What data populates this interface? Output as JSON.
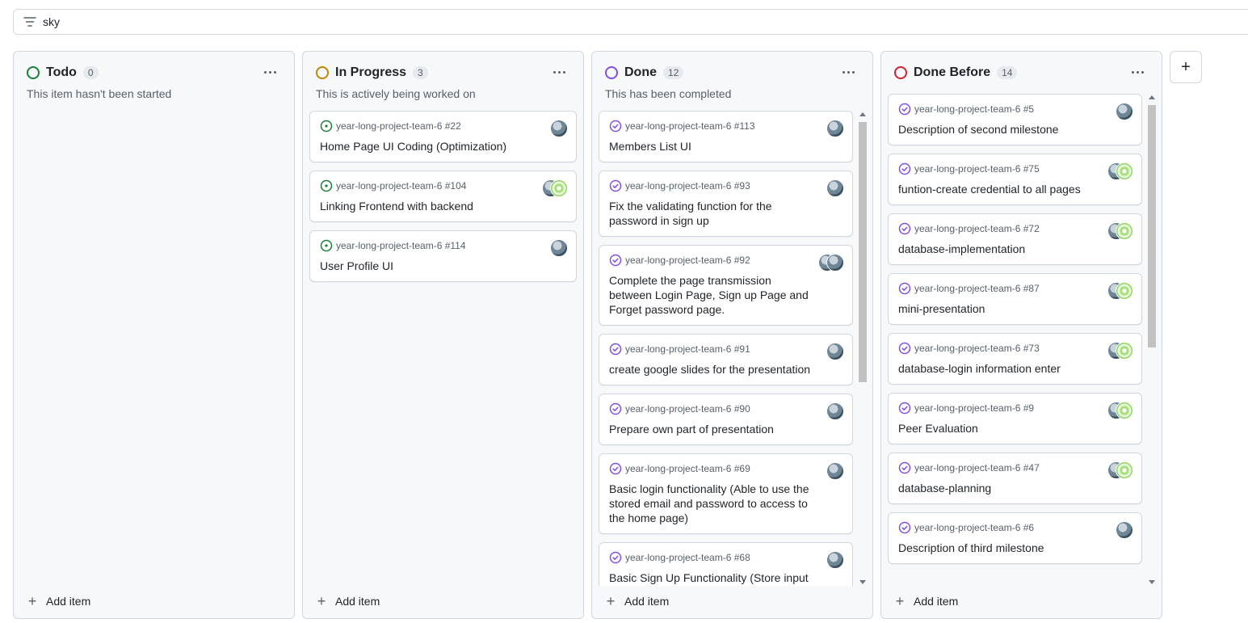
{
  "filter": {
    "query": "sky"
  },
  "columns": [
    {
      "title": "Todo",
      "count": "0",
      "description": "This item hasn't been started",
      "color": "#1a7f37",
      "add_label": "Add item",
      "scroll": false,
      "cards": []
    },
    {
      "title": "In Progress",
      "count": "3",
      "description": "This is actively being worked on",
      "color": "#bf8700",
      "add_label": "Add item",
      "scroll": false,
      "cards": [
        {
          "ref": "year-long-project-team-6 #22",
          "title": "Home Page UI Coding (Optimization)",
          "state": "open",
          "avatars": [
            "photo"
          ]
        },
        {
          "ref": "year-long-project-team-6 #104",
          "title": "Linking Frontend with backend",
          "state": "open",
          "avatars": [
            "photo",
            "green"
          ]
        },
        {
          "ref": "year-long-project-team-6 #114",
          "title": "User Profile UI",
          "state": "open",
          "avatars": [
            "photo"
          ]
        }
      ]
    },
    {
      "title": "Done",
      "count": "12",
      "description": "This has been completed",
      "color": "#8250df",
      "add_label": "Add item",
      "scroll": true,
      "cards": [
        {
          "ref": "year-long-project-team-6 #113",
          "title": "Members List UI",
          "state": "done",
          "avatars": [
            "photo"
          ]
        },
        {
          "ref": "year-long-project-team-6 #93",
          "title": "Fix the validating function for the password in sign up",
          "state": "done",
          "avatars": [
            "photo"
          ]
        },
        {
          "ref": "year-long-project-team-6 #92",
          "title": "Complete the page transmission between Login Page, Sign up Page and Forget password page.",
          "state": "done",
          "avatars": [
            "photo",
            "photo"
          ]
        },
        {
          "ref": "year-long-project-team-6 #91",
          "title": "create google slides for the presentation",
          "state": "done",
          "avatars": [
            "photo"
          ]
        },
        {
          "ref": "year-long-project-team-6 #90",
          "title": "Prepare own part of presentation",
          "state": "done",
          "avatars": [
            "photo"
          ]
        },
        {
          "ref": "year-long-project-team-6 #69",
          "title": "Basic login functionality (Able to use the stored email and password to access to the home page)",
          "state": "done",
          "avatars": [
            "photo"
          ]
        },
        {
          "ref": "year-long-project-team-6 #68",
          "title": "Basic Sign Up Functionality (Store input email and password)",
          "state": "done",
          "avatars": [
            "photo"
          ]
        }
      ]
    },
    {
      "title": "Done Before",
      "count": "14",
      "description": "",
      "color": "#cf222e",
      "add_label": "Add item",
      "scroll": true,
      "cards": [
        {
          "ref": "year-long-project-team-6 #5",
          "title": "Description of second milestone",
          "state": "done",
          "avatars": [
            "photo"
          ]
        },
        {
          "ref": "year-long-project-team-6 #75",
          "title": "funtion-create credential to all pages",
          "state": "done",
          "avatars": [
            "photo",
            "green"
          ]
        },
        {
          "ref": "year-long-project-team-6 #72",
          "title": "database-implementation",
          "state": "done",
          "avatars": [
            "photo",
            "green"
          ]
        },
        {
          "ref": "year-long-project-team-6 #87",
          "title": "mini-presentation",
          "state": "done",
          "avatars": [
            "photo",
            "green"
          ]
        },
        {
          "ref": "year-long-project-team-6 #73",
          "title": "database-login information enter",
          "state": "done",
          "avatars": [
            "photo",
            "green"
          ]
        },
        {
          "ref": "year-long-project-team-6 #9",
          "title": "Peer Evaluation",
          "state": "done",
          "avatars": [
            "photo",
            "green"
          ]
        },
        {
          "ref": "year-long-project-team-6 #47",
          "title": "database-planning",
          "state": "done",
          "avatars": [
            "photo",
            "green"
          ]
        },
        {
          "ref": "year-long-project-team-6 #6",
          "title": "Description of third milestone",
          "state": "done",
          "avatars": [
            "photo"
          ]
        }
      ]
    }
  ],
  "add_column_label": "+"
}
